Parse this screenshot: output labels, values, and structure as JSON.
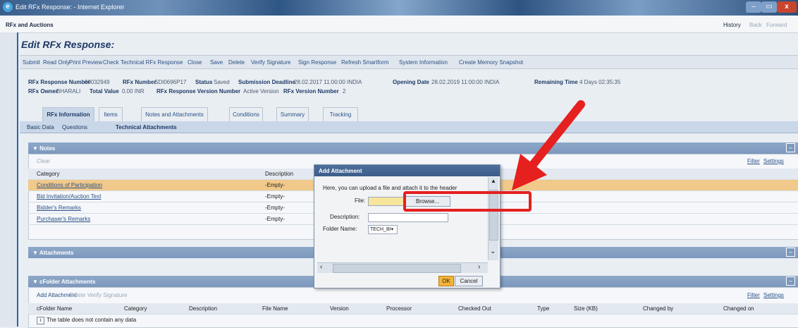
{
  "window": {
    "title": "Edit RFx Response: - Internet Explorer"
  },
  "portal": {
    "title": "RFx and Auctions",
    "history": "History",
    "back": "Back",
    "forward": "Forward"
  },
  "page": {
    "title": "Edit RFx Response:"
  },
  "toolbar": [
    "Submit",
    "Read Only",
    "Print Preview",
    "Check",
    "Technical RFx Response",
    "Close",
    "Save",
    "Delete",
    "Verify Signature",
    "Sign Response",
    "Refresh Smartform",
    "System Information",
    "Create Memory Snapshot"
  ],
  "header": {
    "response_number_label": "RFx Response Number",
    "response_number": "60032949",
    "rfx_number_label": "RFx Number",
    "rfx_number": "SDI0696P17",
    "status_label": "Status",
    "status": "Saved",
    "deadline_label": "Submission Deadline",
    "deadline": "28.02.2017 11:00:00 INDIA",
    "opening_label": "Opening Date",
    "opening": "28.02.2019 11:00:00 INDIA",
    "remaining_label": "Remaining Time",
    "remaining": "4 Days 02:35:35",
    "owner_label": "RFx Owner",
    "owner": "BHARALI",
    "total_label": "Total Value",
    "total": "0.00 INR",
    "version_label": "RFx Response Version Number",
    "version": "Active Version",
    "rfx_version_label": "RFx Version Number",
    "rfx_version": "2"
  },
  "tabs": [
    "RFx Information",
    "Items",
    "Notes and Attachments",
    "Conditions",
    "Summary",
    "Tracking"
  ],
  "subtabs": [
    "Basic Data",
    "Questions",
    "Technical Attachments"
  ],
  "notes": {
    "title": "Notes",
    "clear": "Clear",
    "filter": "Filter",
    "settings": "Settings",
    "col_category": "Category",
    "col_description": "Description",
    "rows": [
      {
        "category": "Conditions of Participation",
        "description": "-Empty-"
      },
      {
        "category": "Bid Invitation/Auction Text",
        "description": "-Empty-"
      },
      {
        "category": "Bidder's Remarks",
        "description": "-Empty-"
      },
      {
        "category": "Purchaser's Remarks",
        "description": "-Empty-"
      }
    ]
  },
  "attachments": {
    "title": "Attachments"
  },
  "cfolder": {
    "title": "cFolder Attachments",
    "add": "Add Attachment",
    "delete": "Delete",
    "verify": "Verify Signature",
    "filter": "Filter",
    "settings": "Settings",
    "columns": [
      "cFolder Name",
      "Category",
      "Description",
      "File Name",
      "Version",
      "Processor",
      "Checked Out",
      "Type",
      "Size (KB)",
      "Changed by",
      "Changed on"
    ],
    "empty": "The table does not contain any data"
  },
  "dialog": {
    "title": "Add Attachment",
    "intro": "Here, you can upload a file and attach it to the header",
    "file_label": "File:",
    "browse": "Browse...",
    "description_label": "Description:",
    "folder_label": "Folder Name:",
    "folder_value": "TECH_BI",
    "ok": "OK",
    "cancel": "Cancel"
  },
  "colors": {
    "annotation": "#e5201f",
    "ok_button": "#f4b43a",
    "selected_row": "#f1c98a"
  }
}
